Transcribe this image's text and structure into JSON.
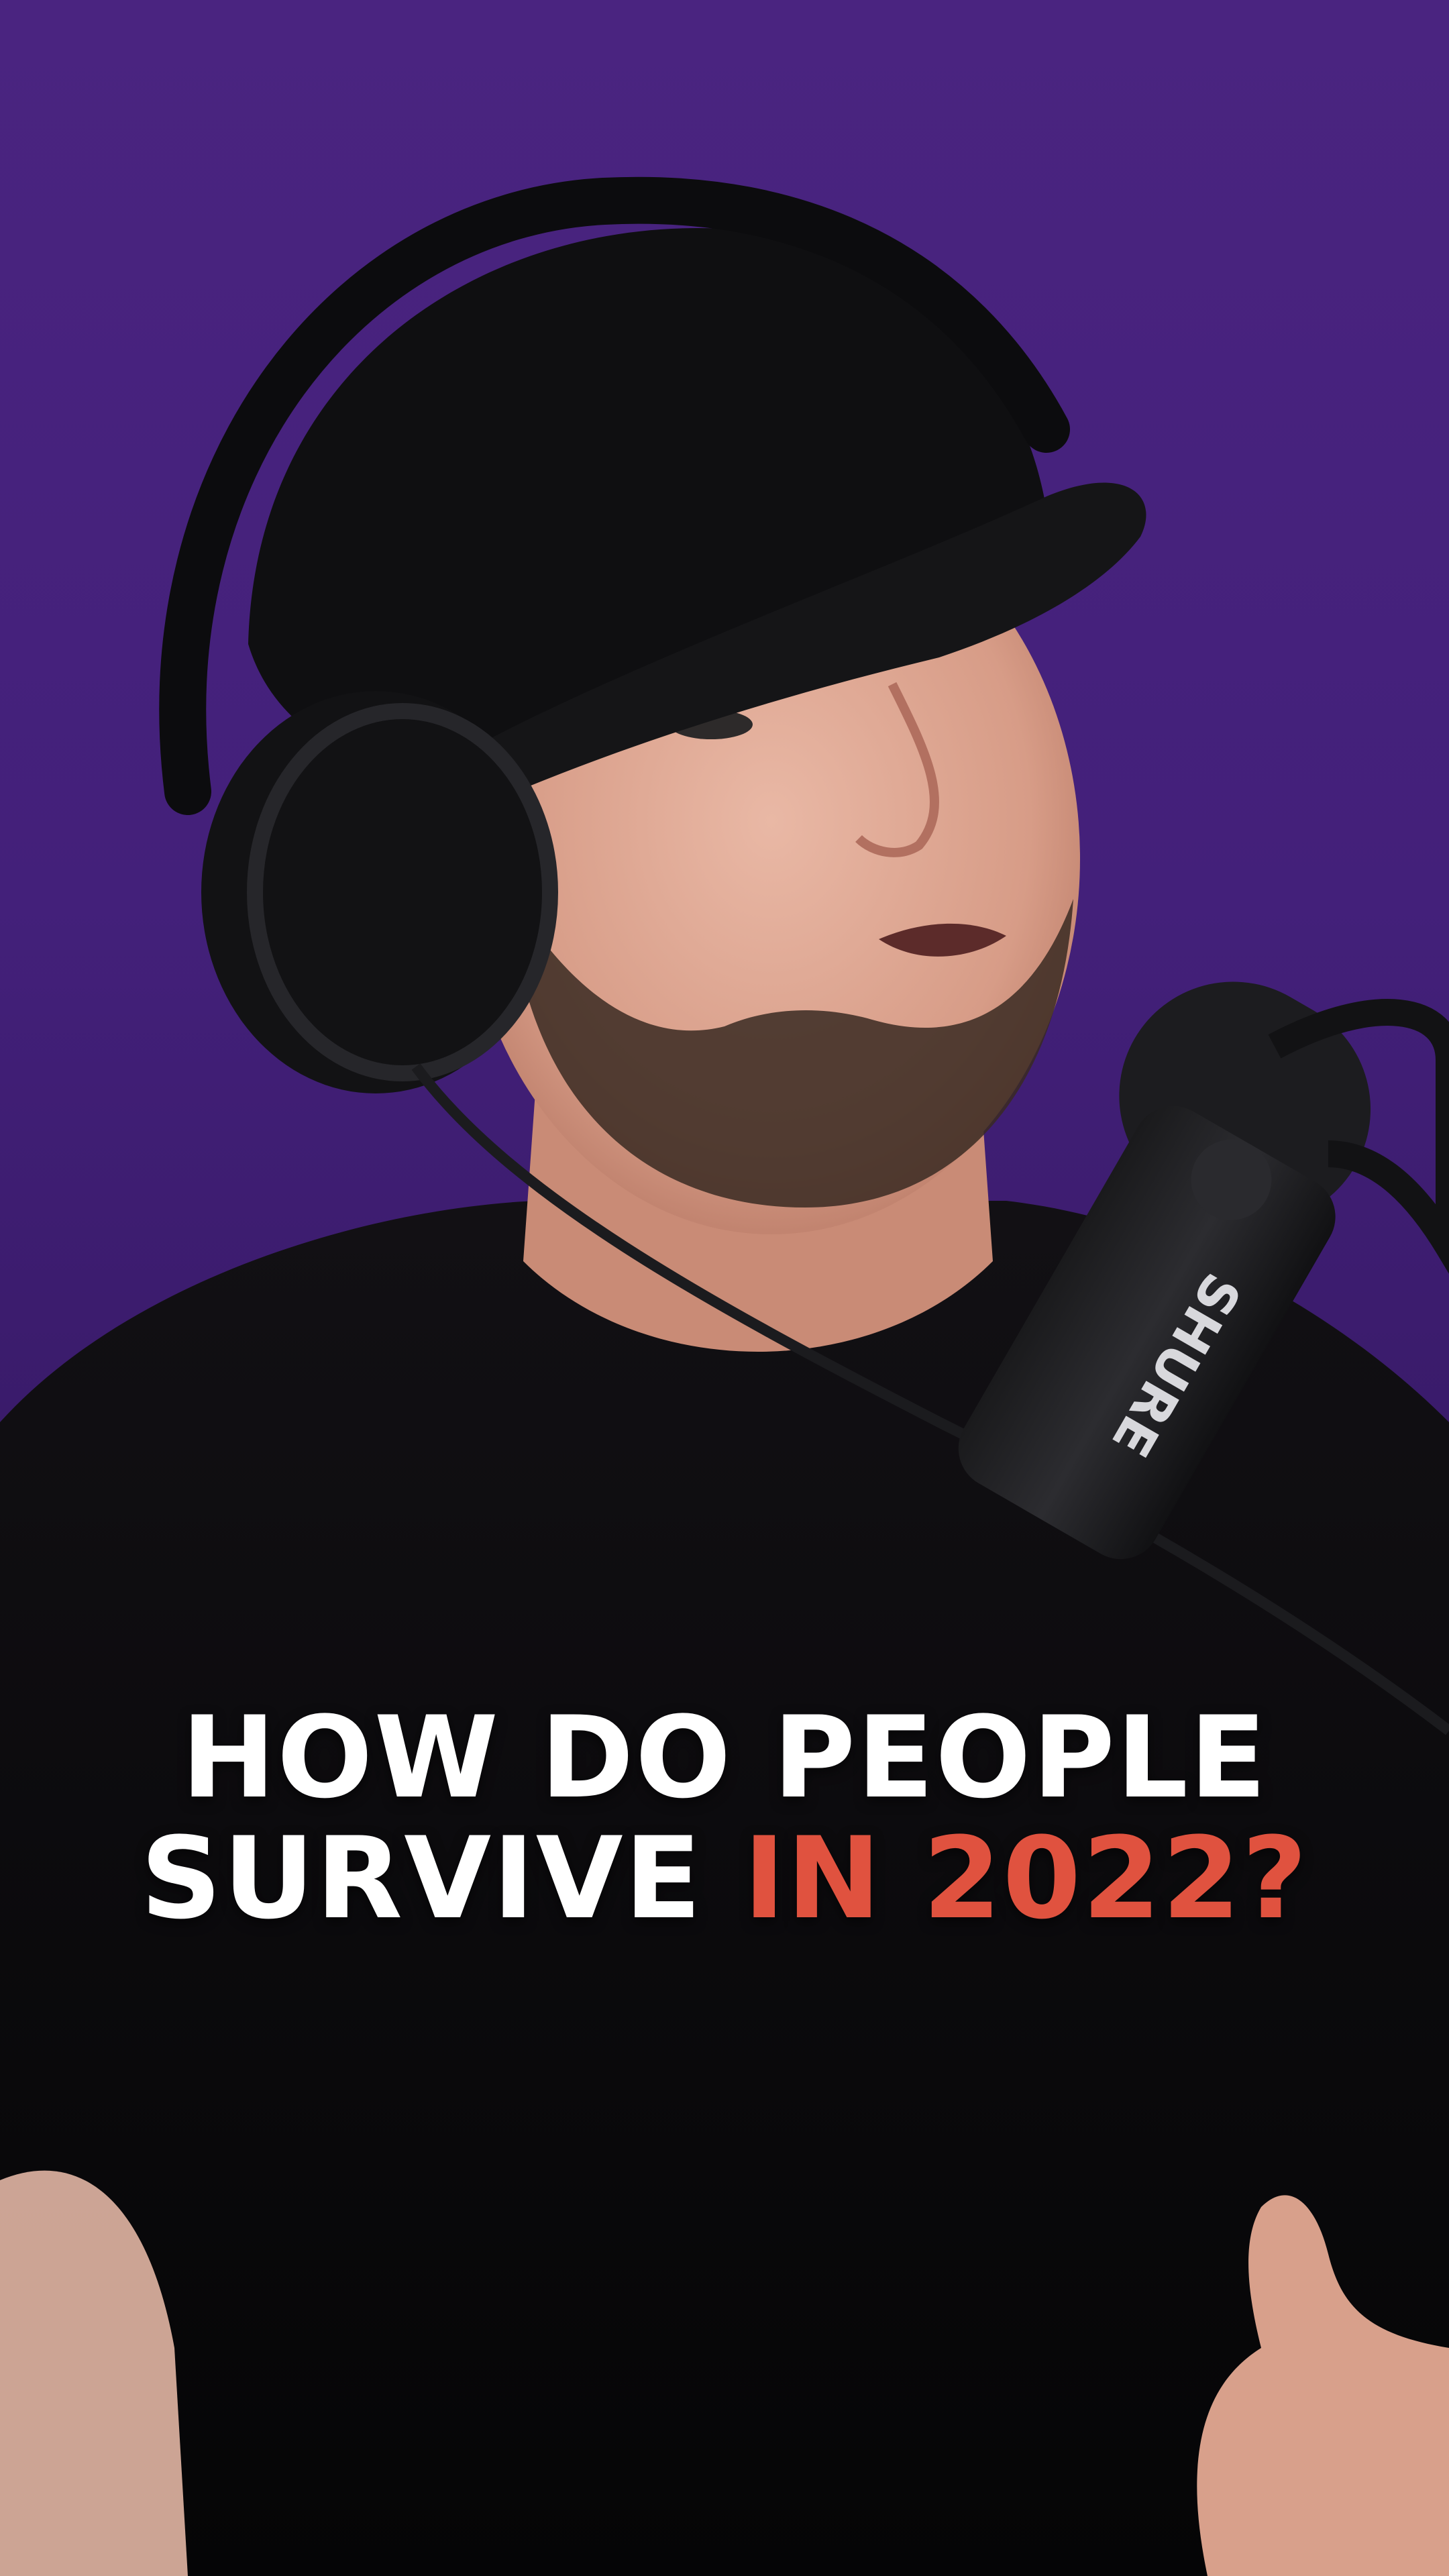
{
  "caption": {
    "line1": "HOW DO PEOPLE",
    "line2_white": "SURVIVE",
    "line2_accent": "IN 2022?",
    "text_color": "#ffffff",
    "accent_color": "#e0523f"
  },
  "scene": {
    "background_color": "#4a2480",
    "microphone_brand": "SHURE"
  }
}
